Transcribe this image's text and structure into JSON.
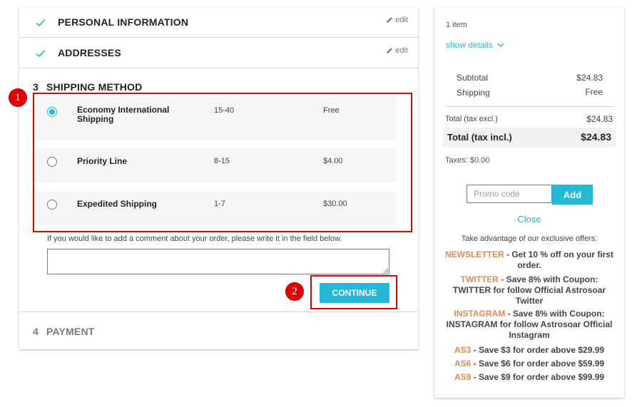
{
  "steps": {
    "personal": {
      "title": "Personal Information",
      "edit": "edit"
    },
    "addresses": {
      "title": "Addresses",
      "edit": "edit"
    },
    "shipping": {
      "number": "3",
      "title": "Shipping Method"
    },
    "payment": {
      "number": "4",
      "title": "Payment"
    }
  },
  "carriers": [
    {
      "name": "Economy International Shipping",
      "delay": "15-40",
      "price": "Free",
      "selected": true
    },
    {
      "name": "Priority Line",
      "delay": "8-15",
      "price": "$4.00",
      "selected": false
    },
    {
      "name": "Expedited Shipping",
      "delay": "1-7",
      "price": "$30.00",
      "selected": false
    }
  ],
  "comment": {
    "label": "If you would like to add a comment about your order, please write it in the field below.",
    "value": ""
  },
  "continue_label": "Continue",
  "annotations": {
    "badge1": "1",
    "badge2": "2"
  },
  "summary": {
    "items_count": "1 item",
    "show_details": "show details",
    "subtotal_label": "Subtotal",
    "subtotal_value": "$24.83",
    "shipping_label": "Shipping",
    "shipping_value": "Free",
    "total_excl_label": "Total (tax excl.)",
    "total_excl_value": "$24.83",
    "total_incl_label": "Total (tax incl.)",
    "total_incl_value": "$24.83",
    "taxes": "Taxes: $0.00",
    "promo_placeholder": "Promo code",
    "promo_add": "Add",
    "close": "Close",
    "offers_intro": "Take advantage of our exclusive offers:",
    "offers": [
      {
        "code": "NEWSLETTER",
        "text": " - Get 10 % off on your first order."
      },
      {
        "code": "TWITTER",
        "text": " - Save 8% with Coupon: TWITTER for follow Official Astrosoar Twitter"
      },
      {
        "code": "INSTAGRAM",
        "text": " - Save 8% with Coupon: INSTAGRAM for follow Astrosoar Official Instagram"
      },
      {
        "code": "AS3",
        "text": " - Save $3 for order above $29.99"
      },
      {
        "code": "AS6",
        "text": " - Save $6 for order above $59.99"
      },
      {
        "code": "AS9",
        "text": " - Save $9 for order above $99.99"
      }
    ]
  },
  "colors": {
    "accent": "#24b9d7",
    "check": "#2fb5a2",
    "highlight": "#e00000",
    "offer_code": "#e08a56"
  }
}
